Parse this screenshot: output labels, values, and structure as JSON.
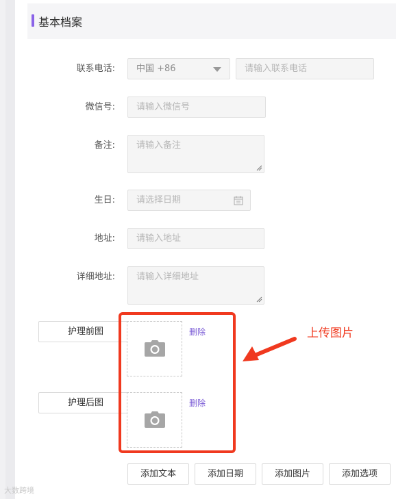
{
  "section": {
    "title": "基本档案"
  },
  "form": {
    "phone": {
      "label": "联系电话:",
      "country": "中国 +86",
      "placeholder": "请输入联系电话"
    },
    "wechat": {
      "label": "微信号:",
      "placeholder": "请输入微信号"
    },
    "remark": {
      "label": "备注:",
      "placeholder": "请输入备注"
    },
    "birthday": {
      "label": "生日:",
      "placeholder": "请选择日期"
    },
    "address": {
      "label": "地址:",
      "placeholder": "请输入地址"
    },
    "detail_address": {
      "label": "详细地址:",
      "placeholder": "请输入详细地址"
    }
  },
  "images": {
    "before": {
      "label": "护理前图",
      "delete": "删除"
    },
    "after": {
      "label": "护理后图",
      "delete": "删除"
    }
  },
  "actions": {
    "add_text": "添加文本",
    "add_date": "添加日期",
    "add_image": "添加图片",
    "add_option": "添加选项"
  },
  "annotation": {
    "text": "上传图片",
    "color": "#f0391f"
  },
  "watermark": "大数跨境",
  "colors": {
    "accent": "#8a63e8",
    "link": "#7b5cd6",
    "highlight": "#f0391f"
  },
  "icons": {
    "camera": "camera-icon",
    "calendar": "calendar-icon",
    "dropdown": "caret-down-icon"
  }
}
